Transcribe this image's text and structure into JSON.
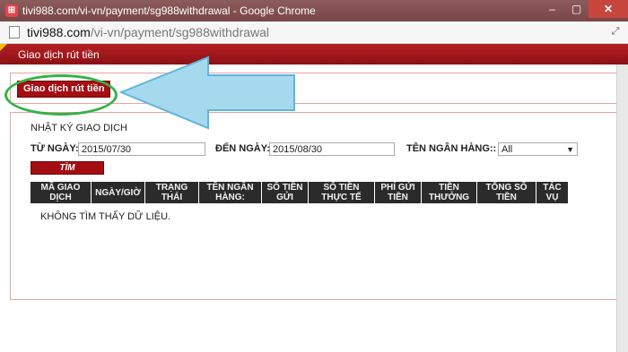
{
  "window": {
    "title": "tivi988.com/vi-vn/payment/sg988withdrawal - Google Chrome",
    "app_icon": "chrome-page-icon",
    "controls": {
      "minimize": "–",
      "maximize": "▢",
      "close": "✕"
    }
  },
  "address": {
    "host": "tivi988.com",
    "path": "/vi-vn/payment/sg988withdrawal"
  },
  "header": {
    "title": "Giao dịch rút tiền"
  },
  "tab": {
    "label": "Giao dịch rút tiền"
  },
  "history": {
    "title": "NHẬT KÝ GIAO DỊCH",
    "from_label": "TỪ NGÀY:",
    "from_value": "2015/07/30",
    "to_label": "ĐẾN NGÀY:",
    "to_value": "2015/08/30",
    "bank_label": "TÊN NGÂN HÀNG::",
    "bank_value": "All",
    "search_label": "TÌM",
    "columns": [
      "MÃ GIAO DỊCH",
      "NGÀY/GIỜ",
      "TRẠNG THÁI",
      "TÊN NGÂN HÀNG:",
      "SỐ TIỀN GỬI",
      "SỐ TIỀN THỰC TẾ",
      "PHÍ GỬI TIỀN",
      "TIỀN THƯỞNG",
      "TỔNG SỐ TIỀN",
      "TÁC VỤ"
    ],
    "empty_message": "KHÔNG TÌM THẤY DỮ LIỆU."
  },
  "colors": {
    "brand_red": "#a40e12",
    "annotation_arrow": "#8fd0ea",
    "annotation_ellipse": "#35b248"
  }
}
